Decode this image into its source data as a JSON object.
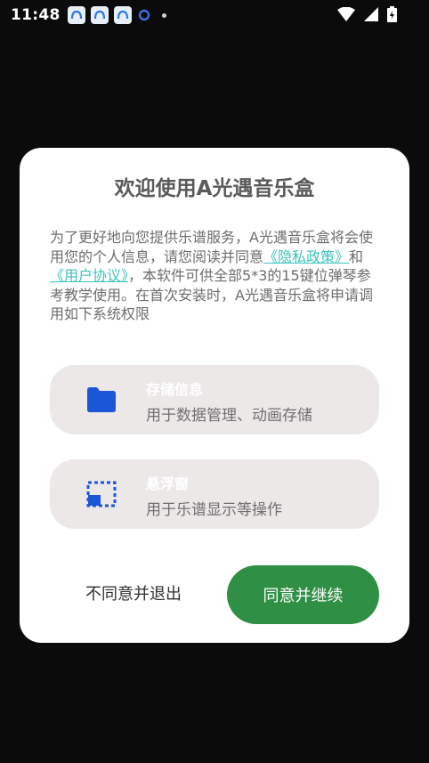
{
  "status_bar": {
    "time": "11:48",
    "notification_icons": [
      "app-icon",
      "app-icon",
      "app-icon",
      "sync-icon"
    ],
    "system_icons": [
      "wifi-icon",
      "signal-icon",
      "battery-charging-icon"
    ]
  },
  "dialog": {
    "title": "欢迎使用A光遇音乐盒",
    "body_intro": "为了更好地向您提供乐谱服务，A光遇音乐盒将会使用您的个人信息，请您阅读并同意",
    "privacy_link": "《隐私政策》",
    "conjunction": "和",
    "user_agreement_link": "《用户协议》",
    "body_rest": "，本软件可供全部5*3的15键位弹琴参考教学使用。在首次安装时，A光遇音乐盒将申请调用如下系统权限",
    "permissions": [
      {
        "title": "存储信息",
        "desc": "用于数据管理、动画存储",
        "icon": "folder-icon"
      },
      {
        "title": "悬浮窗",
        "desc": "用于乐谱显示等操作",
        "icon": "floating-window-icon"
      }
    ],
    "decline_label": "不同意并退出",
    "accept_label": "同意并继续"
  },
  "colors": {
    "accept_button": "#2f8f45",
    "link": "#3dc3bd",
    "icon_blue": "#1c56d8",
    "card_bg": "#ece8e8"
  }
}
